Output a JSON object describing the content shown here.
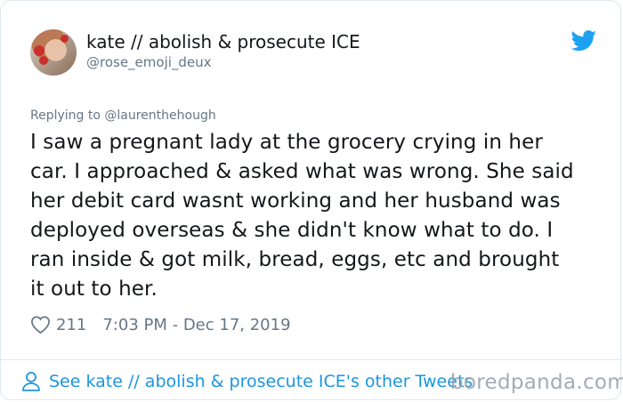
{
  "author": {
    "name": "kate // abolish & prosecute ICE",
    "handle": "@rose_emoji_deux"
  },
  "reply": {
    "text": "Replying to @laurenthehough"
  },
  "tweet": {
    "text": "I saw a pregnant lady at the grocery crying in her\ncar. I approached & asked what was wrong. She said\nher debit card wasnt working and her husband was\ndeployed overseas & she didn't know what to do. I\nran inside & got milk, bread, eggs, etc and brought\nit out to her."
  },
  "meta": {
    "likes": "211",
    "timestamp": "7:03 PM - Dec 17, 2019"
  },
  "footer": {
    "link_text": "See kate // abolish & prosecute ICE's other Tweets"
  },
  "watermark": {
    "text": "boredpanda.com"
  },
  "icons": {
    "platform": "twitter-bird-icon",
    "like": "heart-icon",
    "profile": "person-icon"
  },
  "colors": {
    "link": "#1b95e0",
    "secondary_text": "#657786",
    "border": "#e1e8ed",
    "twitter_blue": "#1da1f2"
  }
}
